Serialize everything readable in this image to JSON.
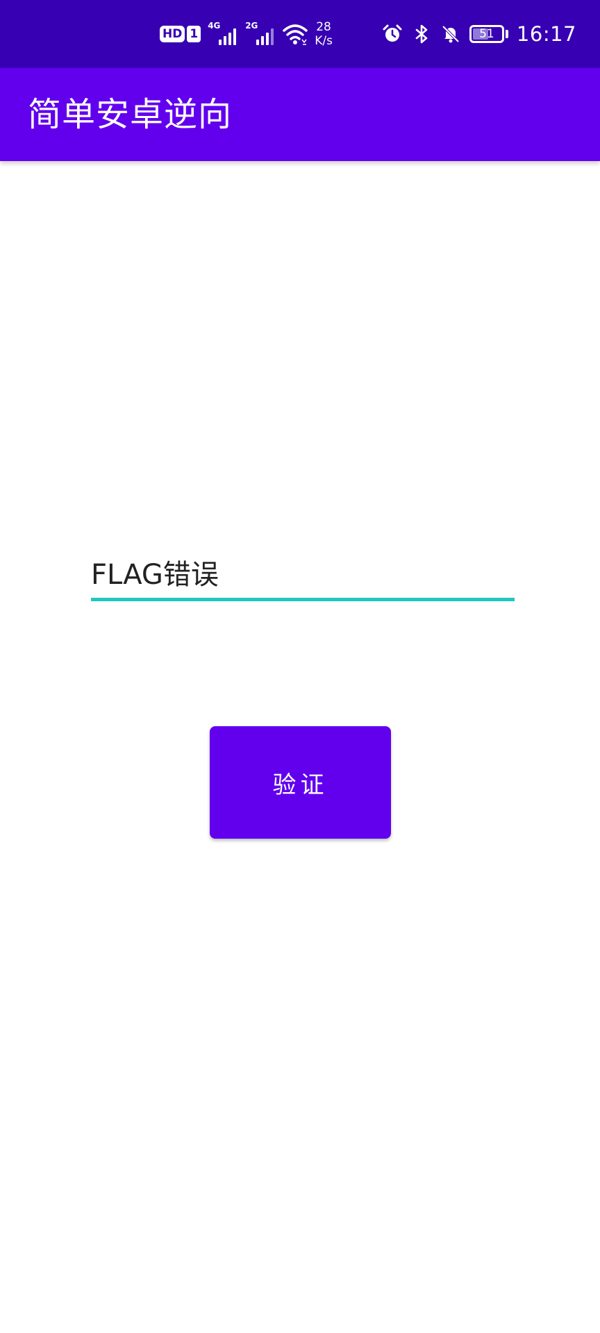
{
  "status_bar": {
    "hd_label": "HD",
    "sim_label": "1",
    "signal1_gen": "4G",
    "signal2_gen": "2G",
    "net_speed_value": "28",
    "net_speed_unit": "K/s",
    "battery_level": "51",
    "time": "16:17",
    "icons": [
      "hd-icon",
      "sim-icon",
      "signal-4g-icon",
      "signal-2g-icon",
      "wifi-icon",
      "alarm-icon",
      "bluetooth-icon",
      "mute-bell-icon",
      "battery-icon"
    ]
  },
  "app_bar": {
    "title": "简单安卓逆向"
  },
  "main": {
    "flag_input_value": "FLAG错误",
    "verify_button_label": "验证"
  },
  "colors": {
    "status_bar_bg": "#3700B3",
    "primary": "#6200EE",
    "input_underline": "#1fc8bf",
    "text_dark": "#222222",
    "on_primary": "#ffffff"
  }
}
